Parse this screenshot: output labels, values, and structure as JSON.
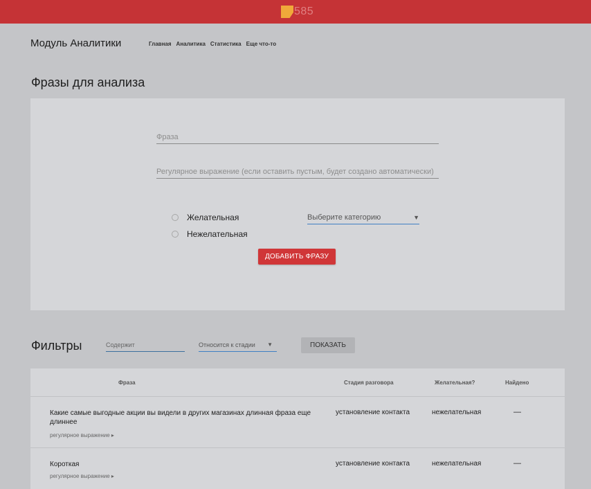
{
  "header": {
    "logo_text": "585"
  },
  "app": {
    "title": "Модуль Аналитики",
    "nav": [
      "Главная",
      "Аналитика",
      "Статистика",
      "Еще что-то"
    ]
  },
  "form": {
    "title": "Фразы для анализа",
    "phrase_placeholder": "Фраза",
    "regex_placeholder": "Регулярное выражение (если оставить пустым, будет создано автоматически)",
    "radio_desirable": "Желательная",
    "radio_undesirable": "Нежелательная",
    "category_placeholder": "Выберите категорию",
    "add_button": "ДОБАВИТЬ ФРАЗУ"
  },
  "filters": {
    "title": "Фильтры",
    "contains_placeholder": "Содержит",
    "stage_placeholder": "Относится к стадии",
    "show_button": "ПОКАЗАТЬ"
  },
  "table": {
    "headers": [
      "Фраза",
      "Стадия разговора",
      "Желательная?",
      "Найдено"
    ],
    "rows": [
      {
        "phrase": "Какие самые выгодные акции вы видели в других магазинах длинная фраза еще длиннее",
        "regex": "регулярное выражение ▸",
        "stage": "установление контакта",
        "desirable": "нежелательная",
        "found": "—"
      },
      {
        "phrase": "Короткая",
        "regex": "регулярное выражение ▸",
        "stage": "установление контакта",
        "desirable": "нежелательная",
        "found": "—"
      }
    ]
  }
}
